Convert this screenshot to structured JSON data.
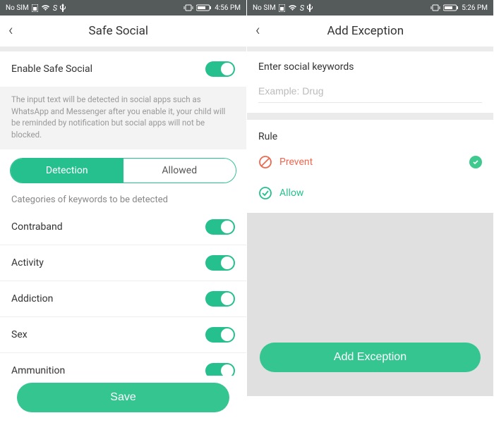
{
  "left": {
    "status": {
      "nosim": "No SIM",
      "time": "4:56 PM"
    },
    "header": {
      "title": "Safe Social"
    },
    "enable": {
      "label": "Enable Safe Social"
    },
    "desc": "The input text will be detected in social apps such as WhatsApp and Messenger after you enable it, your child will be reminded by notification but social apps will not be blocked.",
    "tabs": {
      "detection": "Detection",
      "allowed": "Allowed"
    },
    "subhead": "Categories of keywords to be detected",
    "cats": {
      "c0": "Contraband",
      "c1": "Activity",
      "c2": "Addiction",
      "c3": "Sex",
      "c4": "Ammunition"
    },
    "save": "Save"
  },
  "right": {
    "status": {
      "nosim": "No SIM",
      "time": "5:26 PM"
    },
    "header": {
      "title": "Add Exception"
    },
    "input": {
      "label": "Enter social keywords",
      "placeholder": "Example: Drug"
    },
    "rule": {
      "title": "Rule",
      "prevent": "Prevent",
      "allow": "Allow"
    },
    "add": "Add Exception"
  }
}
